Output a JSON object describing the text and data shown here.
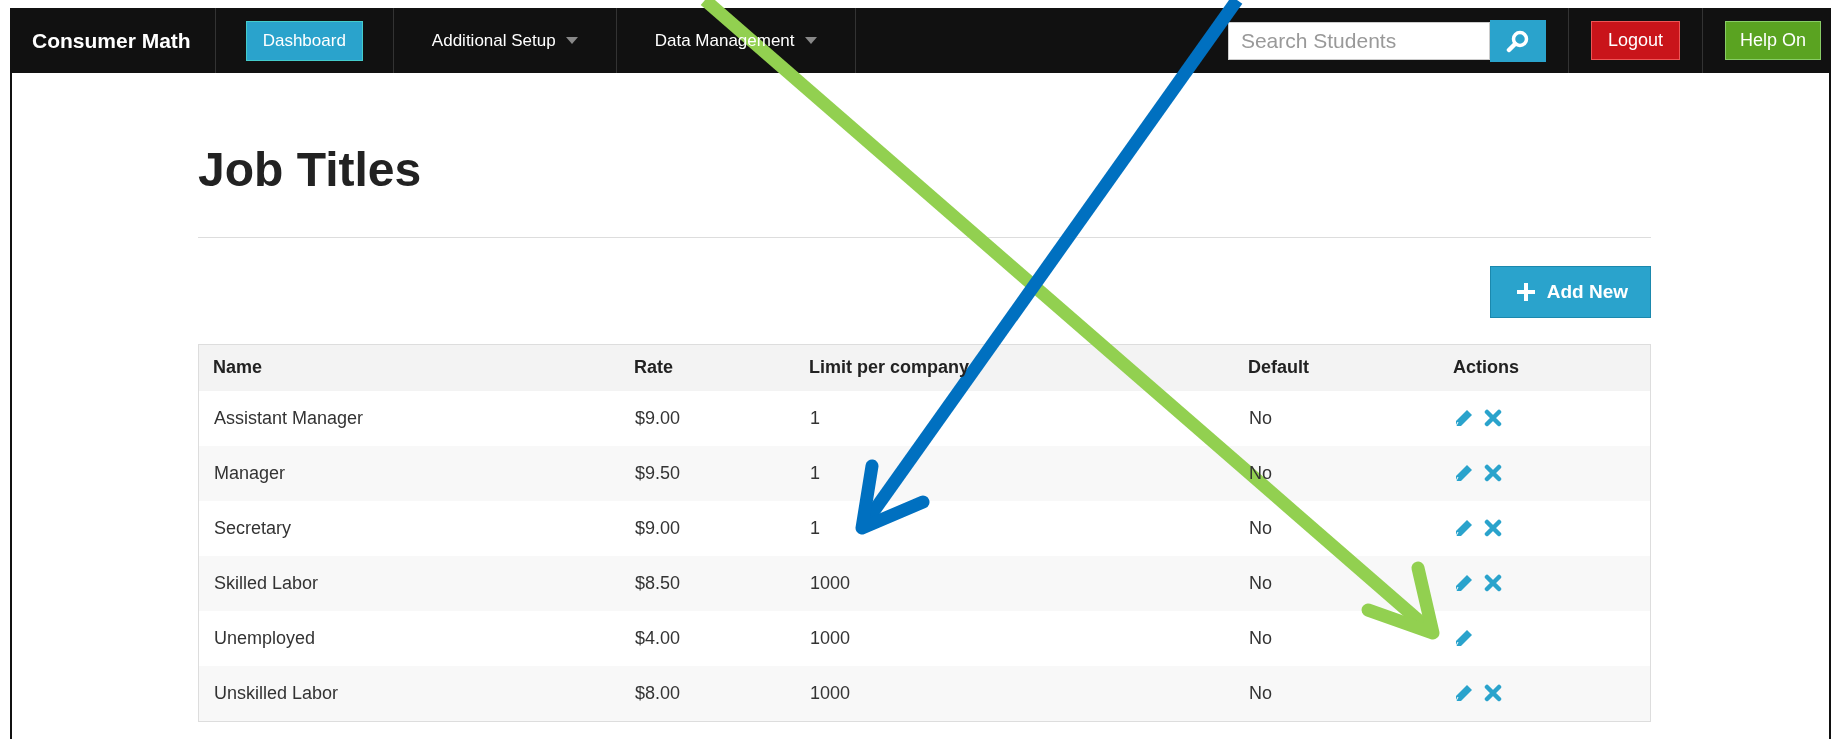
{
  "navbar": {
    "brand": "Consumer Math",
    "items": [
      {
        "label": "Dashboard",
        "kind": "button",
        "selected": true
      },
      {
        "label": "Additional Setup",
        "kind": "dropdown",
        "selected": false
      },
      {
        "label": "Data Management",
        "kind": "dropdown",
        "selected": false
      }
    ],
    "search": {
      "placeholder": "Search Students"
    },
    "logout": "Logout",
    "help": "Help On"
  },
  "page": {
    "title": "Job Titles",
    "add_button": "Add New"
  },
  "table": {
    "columns": [
      "Name",
      "Rate",
      "Limit per company",
      "Default",
      "Actions"
    ],
    "rows": [
      {
        "name": "Assistant Manager",
        "rate": "$9.00",
        "limit": "1",
        "default": "No",
        "deletable": true
      },
      {
        "name": "Manager",
        "rate": "$9.50",
        "limit": "1",
        "default": "No",
        "deletable": true
      },
      {
        "name": "Secretary",
        "rate": "$9.00",
        "limit": "1",
        "default": "No",
        "deletable": true
      },
      {
        "name": "Skilled Labor",
        "rate": "$8.50",
        "limit": "1000",
        "default": "No",
        "deletable": true
      },
      {
        "name": "Unemployed",
        "rate": "$4.00",
        "limit": "1000",
        "default": "No",
        "deletable": false
      },
      {
        "name": "Unskilled Labor",
        "rate": "$8.00",
        "limit": "1000",
        "default": "No",
        "deletable": true
      }
    ]
  }
}
